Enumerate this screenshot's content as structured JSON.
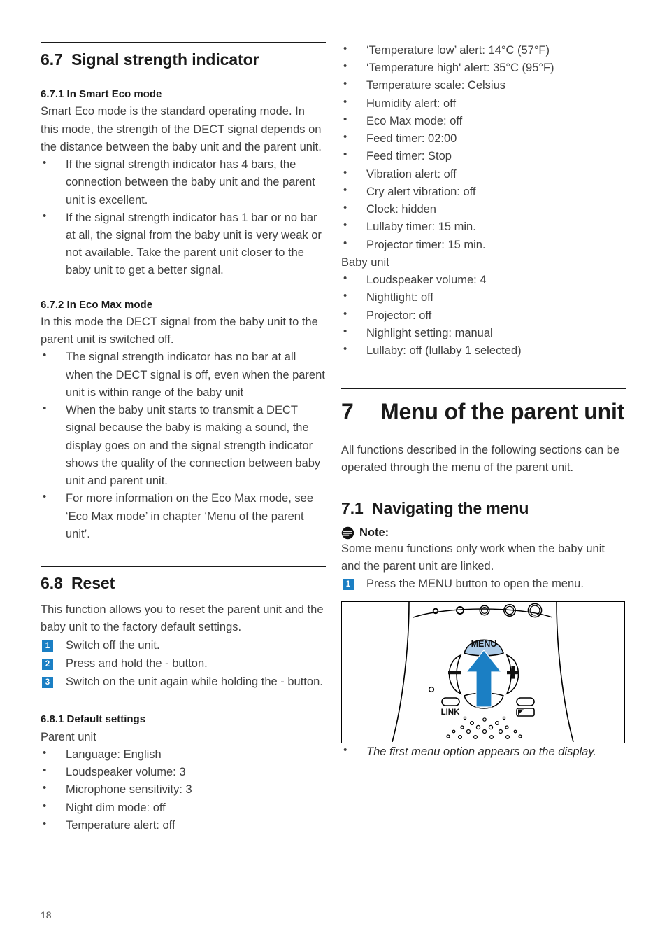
{
  "page": {
    "number": "18",
    "colors": {
      "accent_blue": "#1b7fc4",
      "menu_button_blue": "#aecce8",
      "text": "#3f3f3f",
      "heading": "#1a1a1a"
    }
  },
  "left_column": {
    "section_6_7": {
      "number": "6.7",
      "title": "Signal strength indicator",
      "sub_6_7_1": {
        "heading": "6.7.1 In Smart Eco mode",
        "paragraph": "Smart Eco mode is the standard operating mode. In this mode, the strength of the DECT signal depends on the distance between the baby unit and the parent unit.",
        "bullets": [
          "If the signal strength indicator has 4 bars, the connection between the baby unit and the parent unit is excellent.",
          "If the signal strength indicator has 1 bar or no bar at all, the signal from the baby unit is very weak or not available. Take the parent unit closer to the baby unit to get a better signal."
        ]
      },
      "sub_6_7_2": {
        "heading": "6.7.2 In Eco Max mode",
        "paragraph": "In this mode the DECT signal from the baby unit to the parent unit is switched off.",
        "bullets": [
          "The signal strength indicator has no bar at all when the DECT signal is off, even when the parent unit is within range of the baby unit",
          "When the baby unit starts to transmit a DECT signal because the baby is making a sound, the display goes on and the signal strength indicator shows the quality of the connection between baby unit and parent unit.",
          "For more information on the Eco Max mode, see ‘Eco Max mode’ in chapter ‘Menu of the parent unit’."
        ]
      }
    },
    "section_6_8": {
      "number": "6.8",
      "title": "Reset",
      "paragraph": "This function allows you to reset the parent unit and the baby unit to the factory default settings.",
      "steps": [
        {
          "num": "1",
          "text": "Switch off the unit."
        },
        {
          "num": "2",
          "text": "Press and hold the - button."
        },
        {
          "num": "3",
          "text": "Switch on the unit again while holding the - button."
        }
      ],
      "sub_6_8_1": {
        "heading": "6.8.1 Default settings",
        "group_label": "Parent unit",
        "bullets": [
          "Language: English",
          "Loudspeaker volume: 3",
          "Microphone sensitivity: 3",
          "Night dim mode: off",
          "Temperature alert: off"
        ]
      }
    }
  },
  "right_column": {
    "parent_unit_defaults_continued": [
      "‘Temperature low’ alert: 14°C (57°F)",
      "‘Temperature high' alert: 35°C (95°F)",
      "Temperature scale: Celsius",
      "Humidity alert: off",
      "Eco Max mode: off",
      "Feed timer: 02:00",
      "Feed timer: Stop",
      "Vibration alert: off",
      "Cry alert vibration: off",
      "Clock: hidden",
      "Lullaby timer: 15 min.",
      "Projector timer: 15 min."
    ],
    "baby_unit_label": "Baby unit",
    "baby_unit_defaults": [
      "Loudspeaker volume: 4",
      "Nightlight: off",
      "Projector: off",
      "Nighlight setting: manual",
      "Lullaby: off (lullaby 1 selected)"
    ],
    "chapter_7": {
      "number": "7",
      "title": "Menu of the parent unit",
      "intro": "All functions described in the following sections can be operated through the menu of the parent unit."
    },
    "section_7_1": {
      "number": "7.1",
      "title": "Navigating the menu",
      "note": {
        "icon": "note-icon",
        "title": "Note:",
        "text": "Some menu functions only work when the baby unit and the parent unit are linked."
      },
      "steps": [
        {
          "num": "1",
          "text": "Press the MENU button to open the menu."
        }
      ],
      "figure": {
        "name": "parent-unit-menu-button-illustration",
        "menu_label": "MENU",
        "minus_label": "−",
        "plus_label": "+",
        "link_label": "LINK"
      },
      "caption_bullets": [
        "The first menu option appears on the display."
      ]
    }
  }
}
